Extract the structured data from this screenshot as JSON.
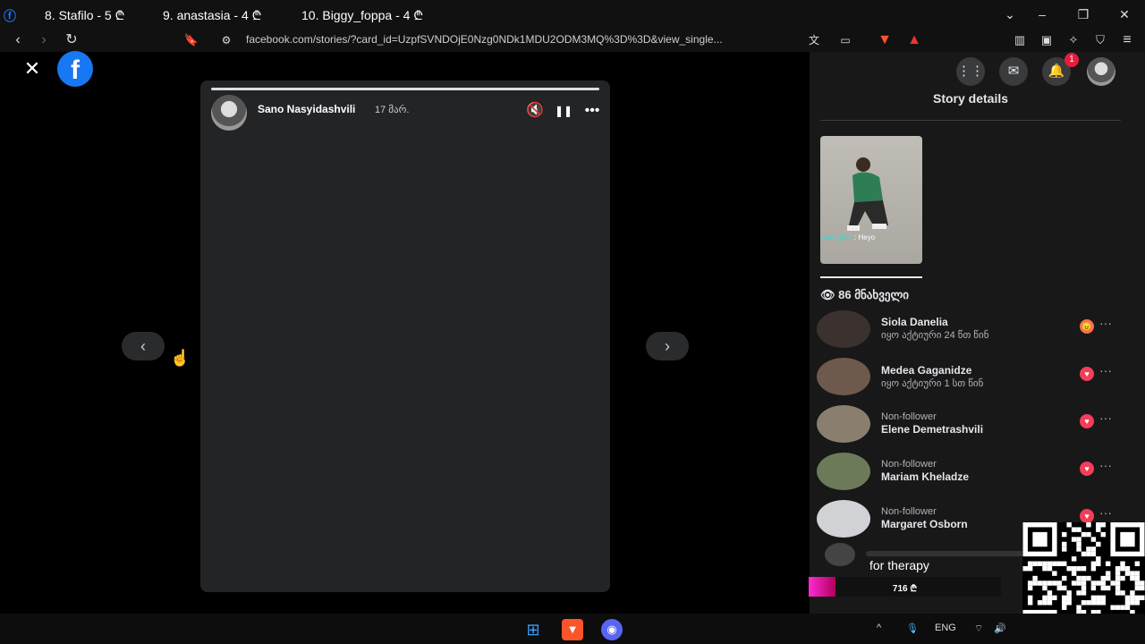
{
  "browser": {
    "tabs": [
      {
        "label": "8. Stafilo - 5 ₾"
      },
      {
        "label": "9. anastasia - 4 ₾"
      },
      {
        "label": "10. Biggy_foppa - 4 ₾"
      }
    ],
    "url": "facebook.com/stories/?card_id=UzpfSVNDOjE0Nzg0NDk1MDU2ODM3MQ%3D%3D&view_single..."
  },
  "story": {
    "author": "Sano Nasyidashvili",
    "time": "17 მარ.",
    "progress": 1.0
  },
  "panel": {
    "notification_count": "1",
    "title": "Story details",
    "thumbnail_caption_user": "total_julia",
    "thumbnail_caption_text": ": Heyo",
    "viewers_count": "86 მნახველი",
    "viewers": [
      {
        "name": "Siola Danelia",
        "sub": "იყო აქტიური 24 წთ წინ",
        "reaction": "angry",
        "reaction_color": "#f7714c"
      },
      {
        "name": "Medea Gaganidze",
        "sub": "იყო აქტიური 1 სთ წინ",
        "reaction": "heart",
        "reaction_color": "#f33e58"
      },
      {
        "label": "Non-follower",
        "name": "Elene Demetrashvili",
        "reaction": "heart",
        "reaction_color": "#f33e58"
      },
      {
        "label": "Non-follower",
        "name": "Mariam Kheladze",
        "reaction": "heart",
        "reaction_color": "#f33e58"
      },
      {
        "label": "Non-follower",
        "name": "Margaret Osborn",
        "reaction": "heart",
        "reaction_color": "#f33e58"
      }
    ]
  },
  "overlay": {
    "message": "for therapy",
    "donation": "716 ₾",
    "donation_progress": 0.14
  },
  "taskbar": {
    "language": "ENG"
  },
  "colors": {
    "facebook_blue": "#1877f2",
    "badge_red": "#e41e3f",
    "panel_bg": "#181818"
  }
}
